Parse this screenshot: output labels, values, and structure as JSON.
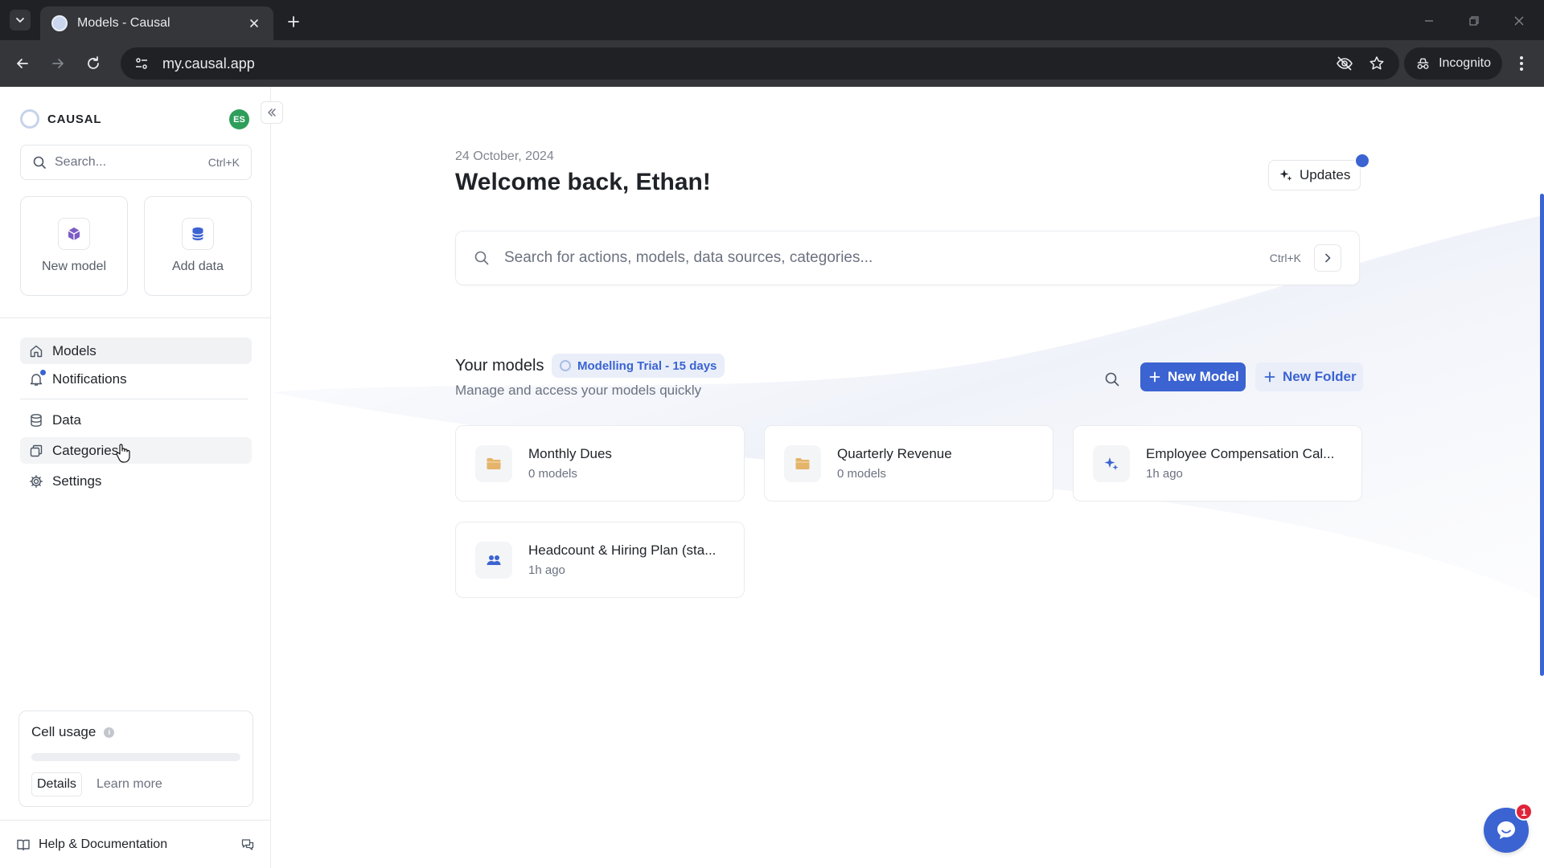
{
  "browser": {
    "tab_title": "Models - Causal",
    "url": "my.causal.app",
    "incognito_label": "Incognito"
  },
  "sidebar": {
    "brand": "CAUSAL",
    "avatar_initials": "ES",
    "search_placeholder": "Search...",
    "search_shortcut": "Ctrl+K",
    "quick_actions": [
      {
        "label": "New model",
        "icon": "cube-icon"
      },
      {
        "label": "Add data",
        "icon": "database-icon"
      }
    ],
    "nav": [
      {
        "label": "Models",
        "icon": "home-icon",
        "active": true
      },
      {
        "label": "Notifications",
        "icon": "bell-icon"
      },
      {
        "label": "Data",
        "icon": "database-icon"
      },
      {
        "label": "Categories",
        "icon": "categories-icon"
      },
      {
        "label": "Settings",
        "icon": "gear-icon"
      }
    ],
    "cell_usage": {
      "title": "Cell usage",
      "used_fraction": 0,
      "details_label": "Details",
      "learn_more_label": "Learn more"
    },
    "help_label": "Help & Documentation"
  },
  "main": {
    "date": "24 October, 2024",
    "welcome": "Welcome back, Ethan!",
    "updates_label": "Updates",
    "search_placeholder": "Search for actions, models, data sources, categories...",
    "search_shortcut": "Ctrl+K",
    "models_title": "Your models",
    "trial_badge": "Modelling Trial - 15 days",
    "models_subtitle": "Manage and access your models quickly",
    "new_model_label": "New Model",
    "new_folder_label": "New Folder",
    "cards": [
      {
        "title": "Monthly Dues",
        "sub": "0 models",
        "icon": "folder-icon"
      },
      {
        "title": "Quarterly Revenue",
        "sub": "0 models",
        "icon": "folder-icon"
      },
      {
        "title": "Employee Compensation Cal...",
        "sub": "1h ago",
        "icon": "sparkle-icon"
      },
      {
        "title": "Headcount & Hiring Plan (sta...",
        "sub": "1h ago",
        "icon": "people-icon"
      }
    ],
    "chat_badge": "1"
  },
  "colors": {
    "accent": "#3b63d1",
    "accent_light": "#e9eef9",
    "avatar": "#2e9e5b",
    "badge_red": "#e0243a",
    "folder": "#e4b46a"
  }
}
